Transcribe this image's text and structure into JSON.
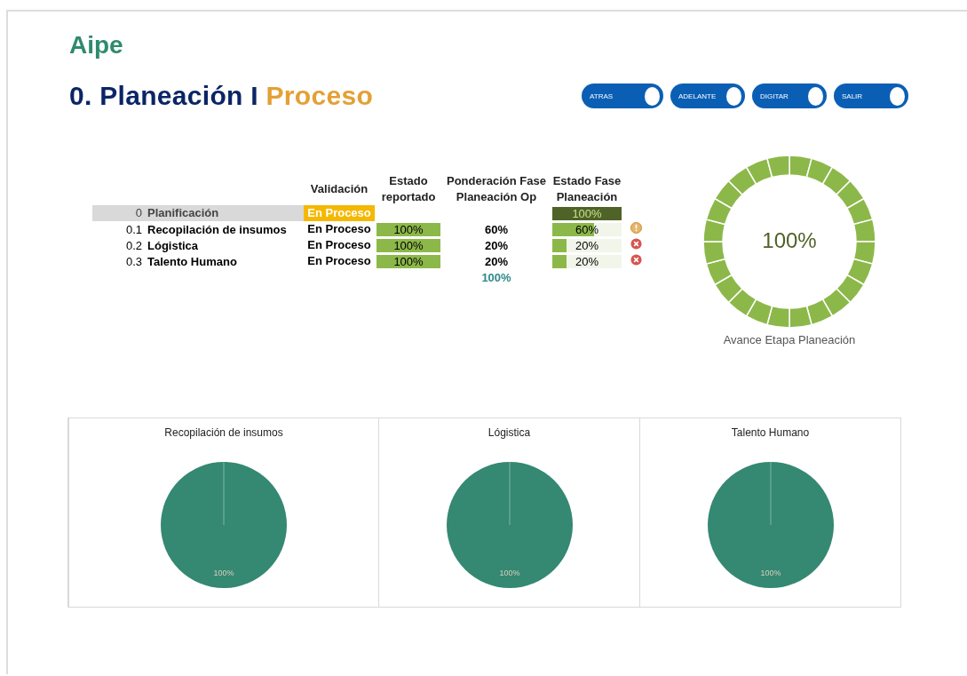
{
  "brand": "Aipe",
  "heading": {
    "prefix": "0. Planeación I",
    "highlight": "Proceso"
  },
  "nav_buttons": [
    {
      "label": "ATRAS",
      "on": true
    },
    {
      "label": "ADELANTE",
      "on": true
    },
    {
      "label": "DIGITAR",
      "on": true
    },
    {
      "label": "SALIR",
      "on": true
    }
  ],
  "table": {
    "columns": [
      "Validación",
      "Estado reportado",
      "Ponderación Fase Planeación Op",
      "Estado Fase Planeación"
    ],
    "rows": [
      {
        "kind": "summary",
        "code": "0",
        "name": "Planificación",
        "validation": "En Proceso",
        "weight": "",
        "phase": {
          "text": "100%",
          "level": 1
        }
      },
      {
        "kind": "item",
        "code": "0.1",
        "name": "Recopilación de insumos",
        "validation": "En Proceso",
        "reported": {
          "text": "100%",
          "level": 1
        },
        "weight": "60%",
        "phase": {
          "text": "60%",
          "level": 0.6
        },
        "alert": {
          "kind": "warning"
        }
      },
      {
        "kind": "item",
        "code": "0.2",
        "name": "Lógistica",
        "validation": "En Proceso",
        "reported": {
          "text": "100%",
          "level": 1
        },
        "weight": "20%",
        "phase": {
          "text": "20%",
          "level": 0.2
        },
        "alert": {
          "kind": "error"
        }
      },
      {
        "kind": "item",
        "code": "0.3",
        "name": "Talento Humano",
        "validation": "En Proceso",
        "reported": {
          "text": "100%",
          "level": 1
        },
        "weight": "20%",
        "phase": {
          "text": "20%",
          "level": 0.2
        },
        "alert": {
          "kind": "error"
        }
      }
    ],
    "weight_total": "100%"
  },
  "gauge": {
    "value": "100%",
    "caption": "Avance Etapa Planeación"
  },
  "pies": [
    {
      "chart_data": {
        "type": "pie",
        "title": "Recopilación de insumos",
        "values": [
          100
        ],
        "value_labels": [
          "100%"
        ]
      }
    },
    {
      "chart_data": {
        "type": "pie",
        "title": "Lógistica",
        "values": [
          100
        ],
        "value_labels": [
          "100%"
        ]
      }
    },
    {
      "chart_data": {
        "type": "pie",
        "title": "Talento Humano",
        "values": [
          100
        ],
        "value_labels": [
          "100%"
        ]
      }
    }
  ]
}
